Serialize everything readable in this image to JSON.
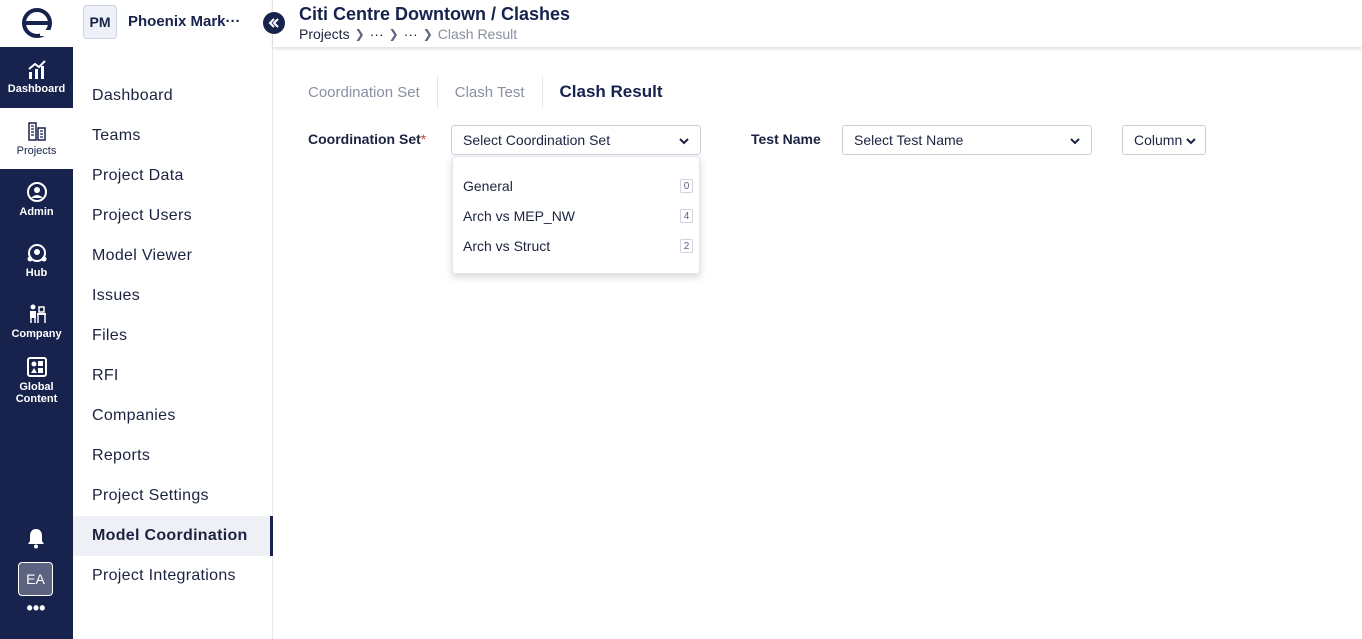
{
  "rail": {
    "items": [
      {
        "label": "Dashboard"
      },
      {
        "label": "Projects"
      },
      {
        "label": "Admin"
      },
      {
        "label": "Hub"
      },
      {
        "label": "Company"
      },
      {
        "label": "Global Content"
      }
    ],
    "user_initials": "EA",
    "more_label": "•••"
  },
  "project": {
    "initials": "PM",
    "name": "Phoenix Mark···"
  },
  "sidebar": {
    "items": [
      {
        "label": "Dashboard"
      },
      {
        "label": "Teams"
      },
      {
        "label": "Project Data"
      },
      {
        "label": "Project Users"
      },
      {
        "label": "Model Viewer"
      },
      {
        "label": "Issues"
      },
      {
        "label": "Files"
      },
      {
        "label": "RFI"
      },
      {
        "label": "Companies"
      },
      {
        "label": "Reports"
      },
      {
        "label": "Project Settings"
      },
      {
        "label": "Model Coordination"
      },
      {
        "label": "Project Integrations"
      }
    ],
    "active": "Model Coordination"
  },
  "header": {
    "title": "Citi Centre Downtown / Clashes",
    "breadcrumb": [
      "Projects",
      "···",
      "···",
      "Clash Result"
    ]
  },
  "tabs": [
    {
      "label": "Coordination Set"
    },
    {
      "label": "Clash Test"
    },
    {
      "label": "Clash Result"
    }
  ],
  "filters": {
    "coordination_set_label": "Coordination Set",
    "required_mark": "*",
    "coordination_set_placeholder": "Select Coordination Set",
    "test_name_label": "Test Name",
    "test_name_placeholder": "Select Test Name",
    "columns_label": "Column"
  },
  "dropdown": {
    "options": [
      {
        "label": "General",
        "count": "0"
      },
      {
        "label": "Arch vs MEP_NW",
        "count": "4"
      },
      {
        "label": "Arch vs Struct",
        "count": "2"
      }
    ]
  },
  "colors": {
    "brand_navy": "#17224d",
    "required_red": "#d23a3a"
  }
}
